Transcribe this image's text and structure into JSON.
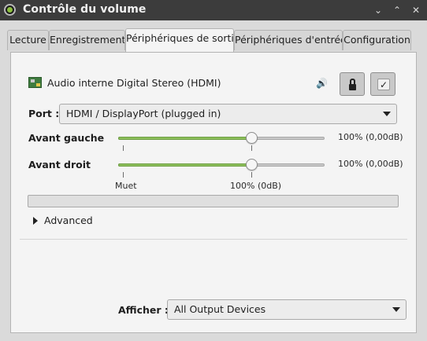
{
  "window": {
    "title": "Contrôle du volume",
    "buttons": [
      "⌄",
      "⌃",
      "✕"
    ]
  },
  "tabs": [
    {
      "label": "Lecture"
    },
    {
      "label": "Enregistrement"
    },
    {
      "label": "Périphériques de sortie",
      "active": true
    },
    {
      "label": "Périphériques d'entrée"
    },
    {
      "label": "Configuration"
    }
  ],
  "device": {
    "name": "Audio interne Digital Stereo (HDMI)",
    "icon": "sound-card-icon",
    "speaker_icon": "speaker-icon",
    "lock_button": {
      "icon": "lock-icon",
      "pressed": true
    },
    "default_button": {
      "icon": "check-icon",
      "pressed": true
    }
  },
  "port": {
    "label": "Port :",
    "value": "HDMI / DisplayPort (plugged in)"
  },
  "channels": [
    {
      "label": "Avant gauche",
      "value_text": "100% (0,00dB)",
      "level": 0.65
    },
    {
      "label": "Avant droit",
      "value_text": "100% (0,00dB)",
      "level": 0.65
    }
  ],
  "scale": {
    "mute_label": "Muet",
    "hundred_label": "100% (0dB)"
  },
  "meter": {
    "level": 0
  },
  "advanced": {
    "label": "Advanced",
    "expanded": false
  },
  "show": {
    "label": "Afficher :",
    "value": "All Output Devices"
  },
  "colors": {
    "titlebar": "#3c3c3c",
    "accent": "#8cbf5a",
    "panel": "#f4f4f4",
    "window_bg": "#dadada"
  }
}
